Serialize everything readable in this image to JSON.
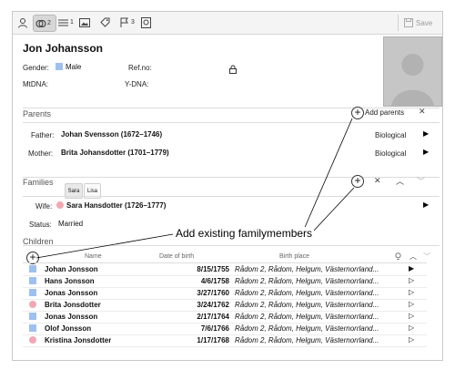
{
  "toolbar": {
    "tabs": [
      {
        "name": "person",
        "badge": ""
      },
      {
        "name": "relations",
        "badge": "2"
      },
      {
        "name": "facts",
        "badge": "1"
      },
      {
        "name": "media",
        "badge": ""
      },
      {
        "name": "tags",
        "badge": ""
      },
      {
        "name": "flags",
        "badge": "3"
      },
      {
        "name": "sources",
        "badge": ""
      }
    ],
    "save_label": "Save"
  },
  "person": {
    "name": "Jon Johansson",
    "gender_label": "Gender:",
    "gender_value": "Male",
    "refno_label": "Ref.no:",
    "mtdna_label": "MtDNA:",
    "ydna_label": "Y-DNA:"
  },
  "parents": {
    "title": "Parents",
    "add_label": "Add parents",
    "father_label": "Father:",
    "father_value": "Johan Svensson (1672–1746)",
    "father_type": "Biological",
    "mother_label": "Mother:",
    "mother_value": "Brita Johansdotter (1701–1779)",
    "mother_type": "Biological"
  },
  "families": {
    "title": "Families",
    "tabs": [
      "Sara",
      "Lisa"
    ],
    "wife_label": "Wife:",
    "wife_value": "Sara Hansdotter (1726–1777)",
    "status_label": "Status:",
    "status_value": "Married"
  },
  "children": {
    "title": "Children",
    "columns": {
      "name": "Name",
      "dob": "Date of birth",
      "pob": "Birth place"
    },
    "rows": [
      {
        "sex": "male",
        "name": "Johan Jonsson",
        "dob": "8/15/1755",
        "pob": "Rådom 2, Rådom, Helgum, Västernorrland...",
        "arrow": "▶"
      },
      {
        "sex": "male",
        "name": "Hans Jonsson",
        "dob": "4/6/1758",
        "pob": "Rådom 2, Rådom, Helgum, Västernorrland...",
        "arrow": "▷"
      },
      {
        "sex": "male",
        "name": "Jonas Jonsson",
        "dob": "3/27/1760",
        "pob": "Rådom 2, Rådom, Helgum, Västernorrland...",
        "arrow": "▷"
      },
      {
        "sex": "female",
        "name": "Brita Jonsdotter",
        "dob": "3/24/1762",
        "pob": "Rådom 2, Rådom, Helgum, Västernorrland...",
        "arrow": "▷"
      },
      {
        "sex": "male",
        "name": "Jonas Jonsson",
        "dob": "2/17/1764",
        "pob": "Rådom 2, Rådom, Helgum, Västernorrland...",
        "arrow": "▷"
      },
      {
        "sex": "male",
        "name": "Olof Jonsson",
        "dob": "7/6/1766",
        "pob": "Rådom 2, Rådom, Helgum, Västernorrland...",
        "arrow": "▷"
      },
      {
        "sex": "female",
        "name": "Kristina Jonsdotter",
        "dob": "1/17/1768",
        "pob": "Rådom 2, Rådom, Helgum, Västernorrland...",
        "arrow": "▷"
      }
    ]
  },
  "annotation": "Add existing familymembers",
  "colors": {
    "male": "#9ec0ef",
    "female": "#f2a7b3"
  }
}
